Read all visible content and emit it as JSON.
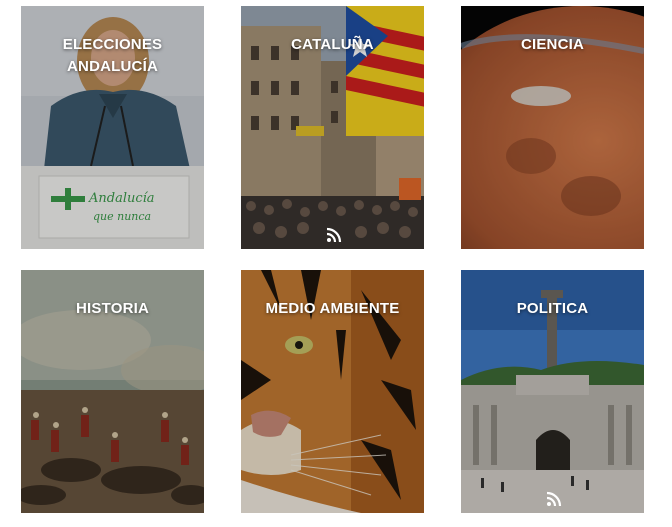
{
  "tiles": [
    {
      "title": "ELECCIONES\nANDALUCÍA",
      "image": "woman-at-podium-photo",
      "sign_text": "Andalucía que nunca",
      "rss": false
    },
    {
      "title": "CATALUÑA",
      "image": "catalan-flag-protest-photo",
      "rss": true
    },
    {
      "title": "CIENCIA",
      "image": "mars-planet-photo",
      "rss": false
    },
    {
      "title": "HISTORIA",
      "image": "battle-painting",
      "rss": false
    },
    {
      "title": "MEDIO AMBIENTE",
      "image": "tiger-closeup-photo",
      "rss": false
    },
    {
      "title": "POLITICA",
      "image": "valley-of-the-fallen-monument-photo",
      "rss": true
    }
  ],
  "colors": {
    "title_text": "#ffffff",
    "rss_icon": "#ffffff"
  }
}
